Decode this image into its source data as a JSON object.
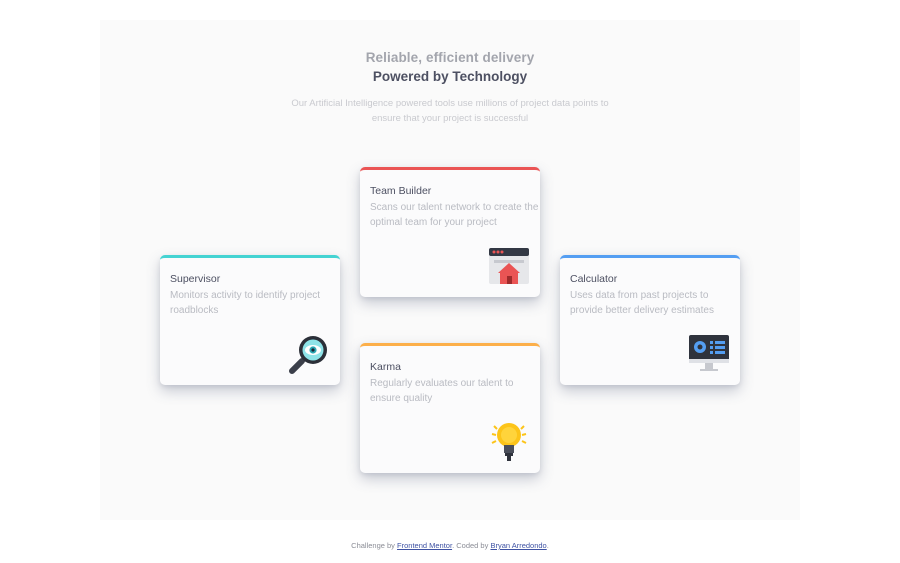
{
  "header": {
    "subtitle": "Reliable, efficient delivery",
    "title": "Powered by Technology",
    "description": "Our Artificial Intelligence powered tools use millions of project data points to ensure that your project is successful"
  },
  "cards": [
    {
      "title": "Supervisor",
      "description": "Monitors activity to identify project roadblocks",
      "accent": "#44d3d2",
      "icon": "magnifying-glass-eye-icon"
    },
    {
      "title": "Team Builder",
      "description": "Scans our talent network to create the optimal team for your project",
      "accent": "#ea5454",
      "icon": "browser-house-icon"
    },
    {
      "title": "Karma",
      "description": "Regularly evaluates our talent to ensure quality",
      "accent": "#fcaf4a",
      "icon": "lightbulb-icon"
    },
    {
      "title": "Calculator",
      "description": "Uses data from past projects to provide better delivery estimates",
      "accent": "#549ef2",
      "icon": "monitor-dashboard-icon"
    }
  ],
  "footer": {
    "prefix": "Challenge by",
    "link1": "Frontend Mentor",
    "middle": ". Coded by",
    "link2": "Bryan Arredondo",
    "suffix": "."
  }
}
